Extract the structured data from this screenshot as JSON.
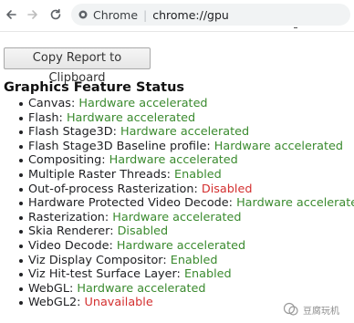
{
  "browser": {
    "site_chip": "Chrome",
    "separator": "|",
    "url": "chrome://gpu"
  },
  "actions": {
    "copy_report_label": "Copy Report to Clipboard"
  },
  "section": {
    "heading": "Graphics Feature Status"
  },
  "features": [
    {
      "name": "Canvas",
      "status": "Hardware accelerated",
      "kind": "enabled"
    },
    {
      "name": "Flash",
      "status": "Hardware accelerated",
      "kind": "enabled"
    },
    {
      "name": "Flash Stage3D",
      "status": "Hardware accelerated",
      "kind": "enabled"
    },
    {
      "name": "Flash Stage3D Baseline profile",
      "status": "Hardware accelerated",
      "kind": "enabled"
    },
    {
      "name": "Compositing",
      "status": "Hardware accelerated",
      "kind": "enabled"
    },
    {
      "name": "Multiple Raster Threads",
      "status": "Enabled",
      "kind": "enabled"
    },
    {
      "name": "Out-of-process Rasterization",
      "status": "Disabled",
      "kind": "disabled"
    },
    {
      "name": "Hardware Protected Video Decode",
      "status": "Hardware accelerated",
      "kind": "enabled"
    },
    {
      "name": "Rasterization",
      "status": "Hardware accelerated",
      "kind": "enabled"
    },
    {
      "name": "Skia Renderer",
      "status": "Disabled",
      "kind": "enabled"
    },
    {
      "name": "Video Decode",
      "status": "Hardware accelerated",
      "kind": "enabled"
    },
    {
      "name": "Viz Display Compositor",
      "status": "Enabled",
      "kind": "enabled"
    },
    {
      "name": "Viz Hit-test Surface Layer",
      "status": "Enabled",
      "kind": "enabled"
    },
    {
      "name": "WebGL",
      "status": "Hardware accelerated",
      "kind": "enabled"
    },
    {
      "name": "WebGL2",
      "status": "Unavailable",
      "kind": "disabled"
    }
  ],
  "watermark": {
    "text": "豆腐玩机"
  },
  "colors": {
    "enabled": "#3a8a2e",
    "disabled": "#d32f2f"
  },
  "icons": {
    "back": "arrow-left-icon",
    "forward": "arrow-right-icon",
    "reload": "reload-icon",
    "site": "chrome-site-icon"
  }
}
